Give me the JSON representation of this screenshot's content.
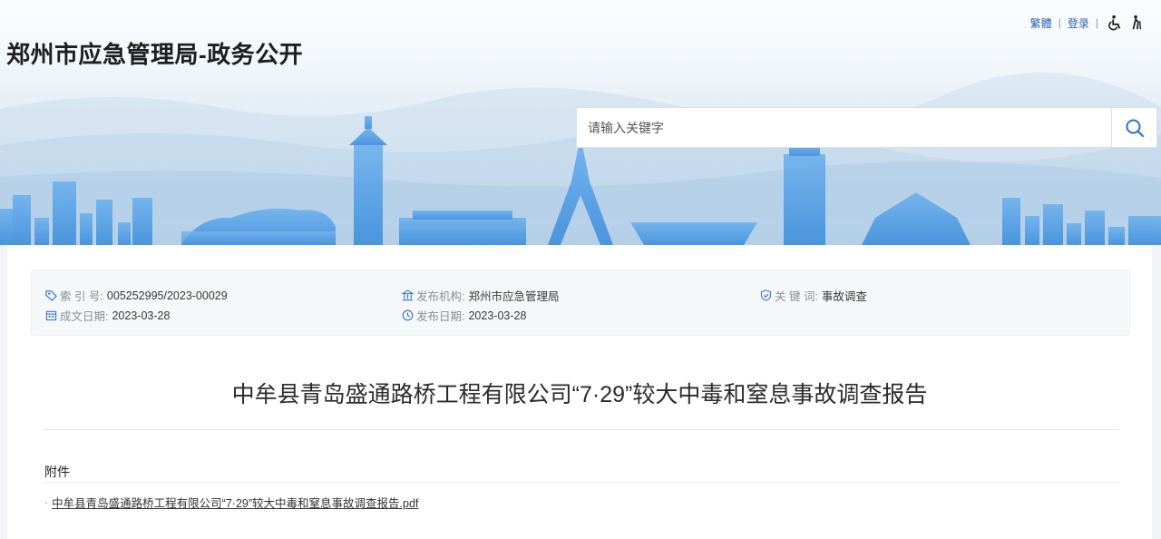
{
  "header": {
    "site_title": "郑州市应急管理局-政务公开",
    "top_links": {
      "traditional": "繁體",
      "login": "登录"
    },
    "search": {
      "placeholder": "请输入关键字"
    }
  },
  "meta": {
    "index_label": "索 引 号:",
    "index_value": "005252995/2023-00029",
    "org_label": "发布机构:",
    "org_value": "郑州市应急管理局",
    "keyword_label": "关 键 词:",
    "keyword_value": "事故调查",
    "created_label": "成文日期:",
    "created_value": "2023-03-28",
    "published_label": "发布日期:",
    "published_value": "2023-03-28"
  },
  "document": {
    "title": "中牟县青岛盛通路桥工程有限公司“7·29”较大中毒和窒息事故调查报告",
    "attachments_heading": "附件",
    "attachments": [
      {
        "dot": "·",
        "name": "中牟县青岛盛通路桥工程有限公司“7·29”较大中毒和窒息事故调查报告.pdf"
      }
    ]
  },
  "icons": {
    "tag": "tag-icon",
    "building": "government-building-icon",
    "shield": "shield-check-icon",
    "calendar": "calendar-icon",
    "clock": "clock-icon",
    "search": "search-icon",
    "accessibility": "wheelchair-icon",
    "elder": "elder-care-icon"
  },
  "colors": {
    "link_blue": "#2a62b5",
    "skyline_blue": "#4f9ae0",
    "icon_blue": "#2f6fd0"
  }
}
